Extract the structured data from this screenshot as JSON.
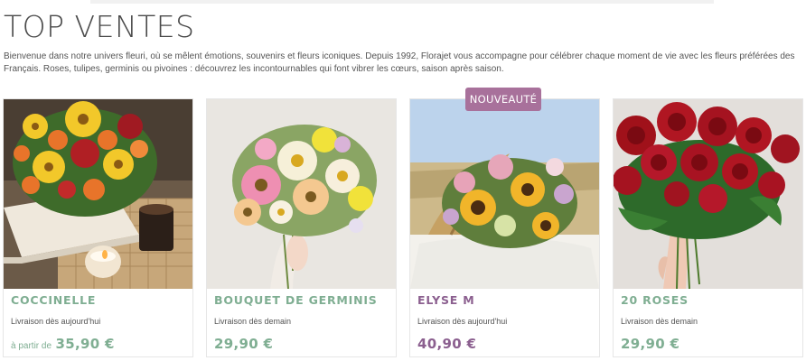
{
  "page": {
    "title": "TOP VENTES",
    "intro": "Bienvenue dans notre univers fleuri, où se mêlent émotions, souvenirs et fleurs iconiques. Depuis 1992, Florajet vous accompagne pour célébrer chaque moment de vie avec les fleurs préférées des Français. Roses, tulipes, germinis ou pivoines : découvrez les incontournables qui font vibrer les cœurs, saison après saison."
  },
  "products": [
    {
      "name": "COCCINELLE",
      "delivery": "Livraison dès aujourd'hui",
      "price_prefix": "à partir de",
      "price": "35,90 €",
      "accent": "#7fae92"
    },
    {
      "name": "BOUQUET DE GERMINIS",
      "delivery": "Livraison dès demain",
      "price_prefix": "",
      "price": "29,90 €",
      "accent": "#7fae92"
    },
    {
      "name": "ELYSE M",
      "delivery": "Livraison dès aujourd'hui",
      "price_prefix": "",
      "price": "40,90 €",
      "badge": "NOUVEAUTÉ",
      "accent": "#8b5f8f"
    },
    {
      "name": "20 ROSES",
      "delivery": "Livraison dès demain",
      "price_prefix": "",
      "price": "29,90 €",
      "accent": "#7fae92"
    }
  ]
}
